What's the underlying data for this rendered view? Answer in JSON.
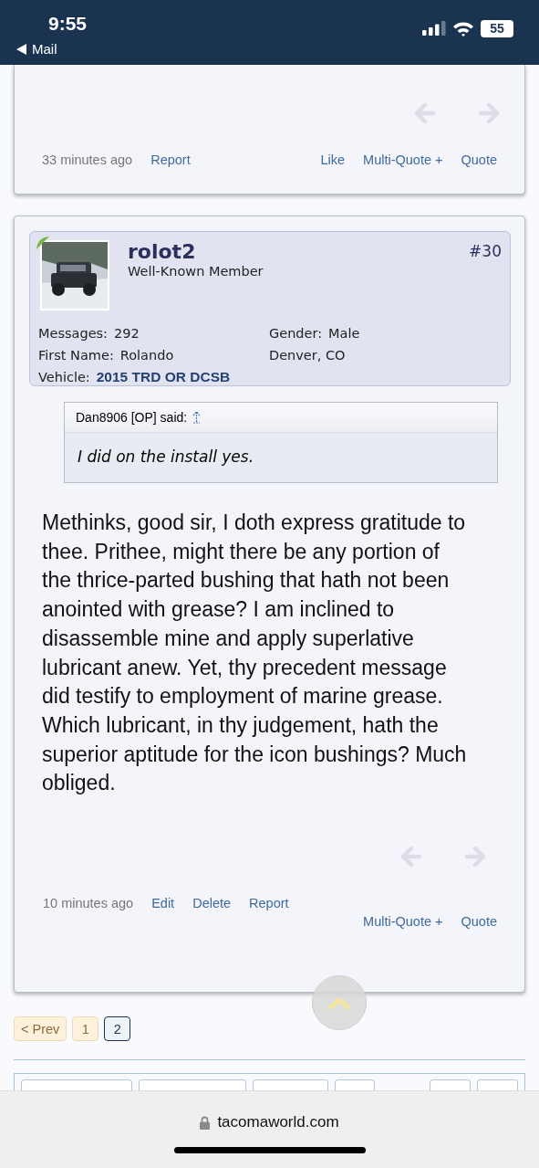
{
  "status_bar": {
    "time": "9:55",
    "back_label": "Mail",
    "battery": "55"
  },
  "posts": [
    {
      "kind": "tail",
      "time": "33 minutes ago",
      "actions_left": [
        "Report"
      ],
      "actions_right": [
        "Like",
        "Multi-Quote +",
        "Quote"
      ]
    },
    {
      "kind": "full",
      "user": {
        "name": "rolot2",
        "title": "Well-Known Member",
        "online": true,
        "fields": [
          {
            "label": "Messages:",
            "value": "292"
          },
          {
            "label": "Gender:",
            "value": "Male"
          },
          {
            "label": "First Name:",
            "value": "Rolando"
          },
          {
            "value": "Denver, CO"
          },
          {
            "label": "Vehicle:",
            "value": "2015 TRD OR DCSB",
            "kind": "vehicle"
          }
        ]
      },
      "number": "#30",
      "quote": {
        "author": "Dan8906 [OP] said:",
        "text": "I did on the install yes."
      },
      "body": "Methinks, good sir, I doth express gratitude to thee. Prithee, might there be any portion of the thrice-parted bushing that hath not been anointed with grease? I am inclined to disassemble mine and apply superlative lubricant anew. Yet, thy precedent message did testify to employment of marine grease. Which lubricant, in thy judgement, hath the superior aptitude for the icon bushings? Much obliged.",
      "time": "10 minutes ago",
      "actions_left": [
        "Edit",
        "Delete",
        "Report"
      ],
      "actions_right": [
        "Multi-Quote +",
        "Quote"
      ]
    }
  ],
  "pagination": [
    {
      "label": "< Prev",
      "selected": false
    },
    {
      "label": "1",
      "selected": false
    },
    {
      "label": "2",
      "selected": true
    }
  ],
  "address_bar": {
    "url": "tacomaworld.com"
  }
}
